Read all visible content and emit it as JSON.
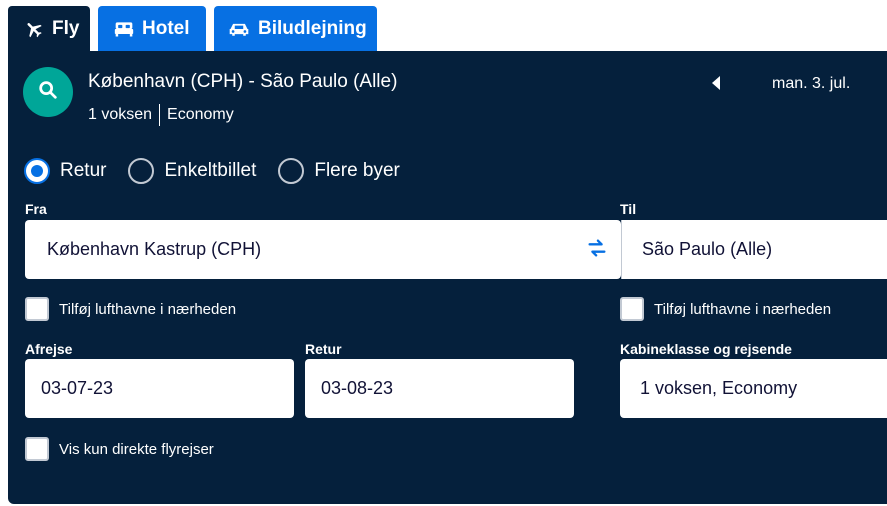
{
  "tabs": [
    {
      "label": "Fly",
      "icon": "plane-icon",
      "active": true
    },
    {
      "label": "Hotel",
      "icon": "bed-icon",
      "active": false
    },
    {
      "label": "Biludlejning",
      "icon": "car-icon",
      "active": false
    }
  ],
  "summary": {
    "route": "København (CPH) - São Paulo (Alle)",
    "travelers": "1 voksen",
    "cabin": "Economy",
    "date": "man. 3. jul."
  },
  "trip_types": [
    {
      "label": "Retur",
      "selected": true
    },
    {
      "label": "Enkeltbillet",
      "selected": false
    },
    {
      "label": "Flere byer",
      "selected": false
    }
  ],
  "from": {
    "label": "Fra",
    "value": "København Kastrup (CPH)"
  },
  "to": {
    "label": "Til",
    "value": "São Paulo (Alle)"
  },
  "nearby_from": {
    "label": "Tilføj lufthavne i nærheden",
    "checked": false
  },
  "nearby_to": {
    "label": "Tilføj lufthavne i nærheden",
    "checked": false
  },
  "depart": {
    "label": "Afrejse",
    "value": "03-07-23"
  },
  "return": {
    "label": "Retur",
    "value": "03-08-23"
  },
  "cabin_travelers": {
    "label": "Kabineklasse og rejsende",
    "value": "1 voksen, Economy"
  },
  "direct_only": {
    "label": "Vis kun direkte flyrejser",
    "checked": false
  },
  "colors": {
    "panel": "#05203c",
    "tab_inactive": "#0770e3",
    "search_circle": "#00a698",
    "radio_selected": "#0770e3",
    "swap_icon": "#0770e3"
  }
}
